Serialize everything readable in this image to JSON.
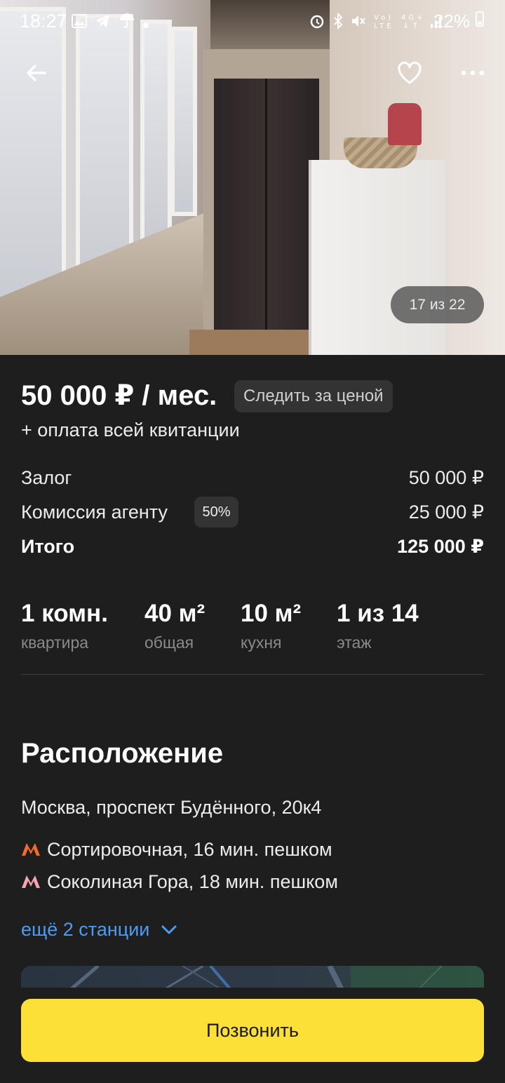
{
  "status_bar": {
    "time": "18:27",
    "battery": "22%"
  },
  "photo": {
    "counter": "17 из 22"
  },
  "price": {
    "main": "50 000 ₽ / мес.",
    "follow_label": "Следить за ценой",
    "extra": "+ оплата всей квитанции"
  },
  "costs": [
    {
      "label": "Залог",
      "value": "50 000 ₽"
    },
    {
      "label": "Комиссия агенту",
      "badge": "50%",
      "value": "25 000 ₽"
    },
    {
      "label": "Итого",
      "value": "125 000 ₽"
    }
  ],
  "specs": [
    {
      "value": "1 комн.",
      "caption": "квартира"
    },
    {
      "value": "40 м²",
      "caption": "общая"
    },
    {
      "value": "10 м²",
      "caption": "кухня"
    },
    {
      "value": "1 из 14",
      "caption": "этаж"
    }
  ],
  "location": {
    "title": "Расположение",
    "address": "Москва, проспект Будённого, 20к4",
    "metro": [
      {
        "text": "Сортировочная, 16 мин. пешком",
        "color": "#f26b2a"
      },
      {
        "text": "Соколиная Гора, 18 мин. пешком",
        "color": "#f5a3b3"
      }
    ],
    "more_label": "ещё 2 станции"
  },
  "actions": {
    "call_label": "Позвонить"
  },
  "colors": {
    "accent_yellow": "#fce037",
    "link_blue": "#4d9cf0",
    "background": "#1e1e1e"
  }
}
